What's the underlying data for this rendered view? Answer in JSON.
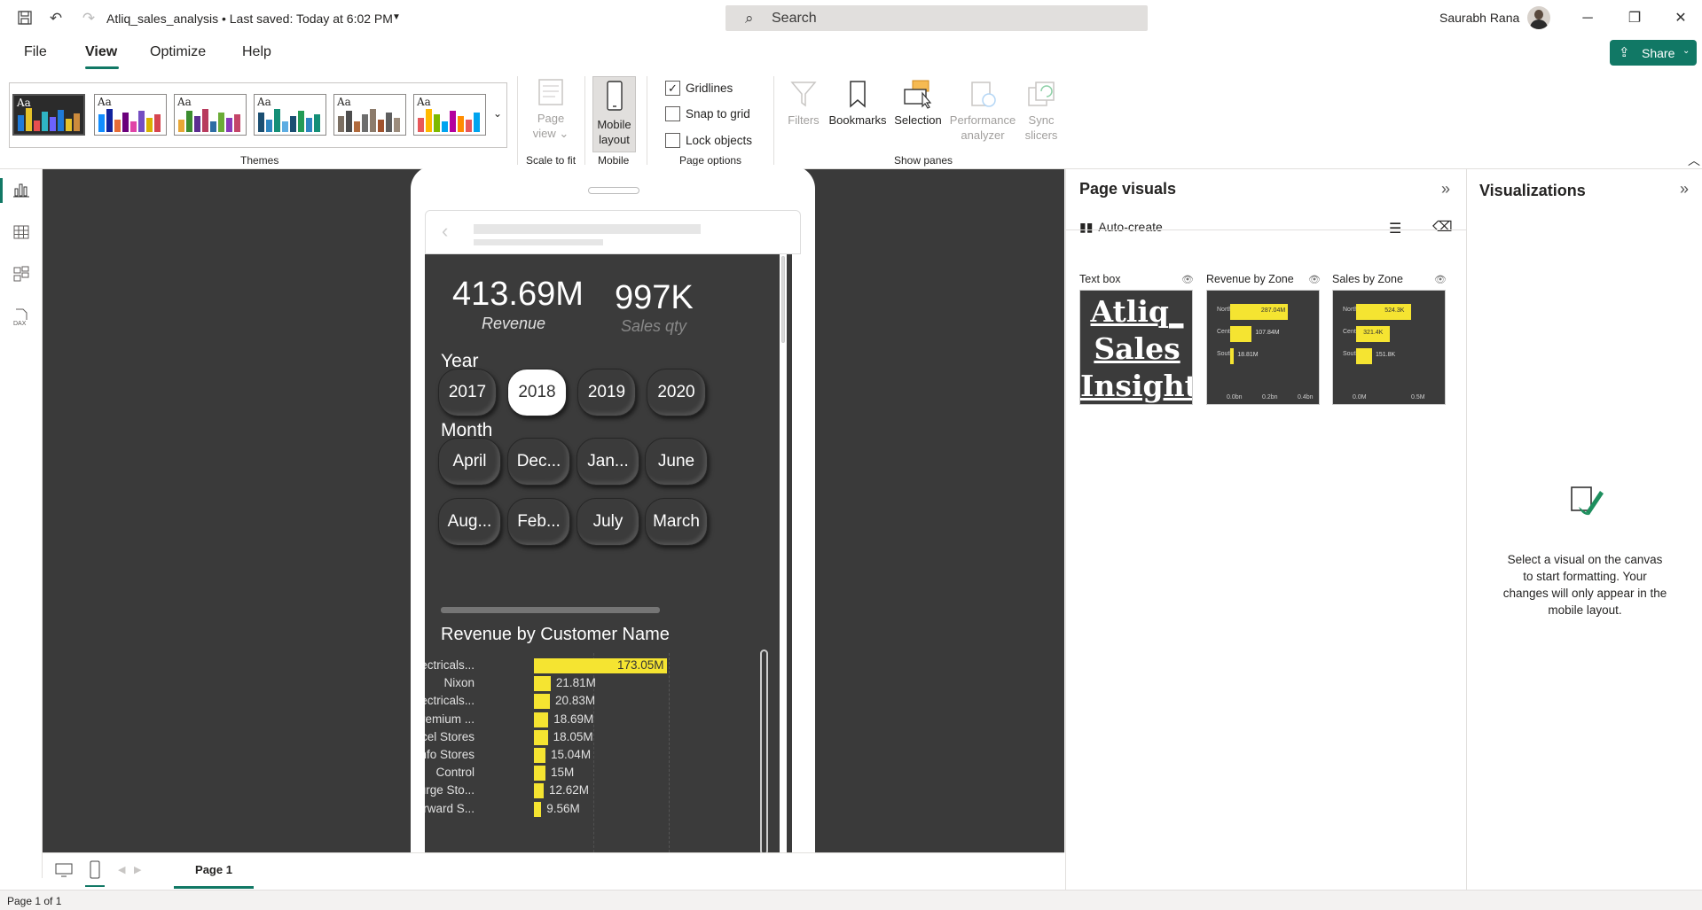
{
  "titlebar": {
    "doc_title": "Atliq_sales_analysis • Last saved: Today at 6:02 PM",
    "search_placeholder": "Search",
    "user_name": "Saurabh Rana"
  },
  "menu": {
    "tabs": [
      "File",
      "View",
      "Optimize",
      "Help"
    ],
    "share_label": "Share"
  },
  "ribbon": {
    "theme_aa": "Aa",
    "groups": {
      "themes": "Themes",
      "scale": "Scale to fit",
      "mobile": "Mobile",
      "page_options": "Page options",
      "show_panes": "Show panes"
    },
    "page_view": [
      "Page",
      "view"
    ],
    "mobile_layout": [
      "Mobile",
      "layout"
    ],
    "checks": [
      {
        "label": "Gridlines",
        "checked": true
      },
      {
        "label": "Snap to grid",
        "checked": false
      },
      {
        "label": "Lock objects",
        "checked": false
      }
    ],
    "panes": {
      "filters": "Filters",
      "bookmarks": "Bookmarks",
      "selection": "Selection",
      "perf": [
        "Performance",
        "analyzer"
      ],
      "sync": [
        "Sync",
        "slicers"
      ]
    }
  },
  "canvas": {
    "kpi_revenue": {
      "value": "413.69M",
      "label": "Revenue"
    },
    "kpi_qty": {
      "value": "997K",
      "label": "Sales qty"
    },
    "year_title": "Year",
    "years": [
      "2017",
      "2018",
      "2019",
      "2020"
    ],
    "selected_year": "2018",
    "month_title": "Month",
    "months": [
      "April",
      "Dec...",
      "Jan...",
      "June",
      "Aug...",
      "Feb...",
      "July",
      "March"
    ],
    "revenue_chart_title": "Revenue by Customer Name"
  },
  "chart_data": [
    {
      "type": "bar",
      "title": "Revenue by Customer Name",
      "categories": [
        "Electricals...",
        "Nixon",
        "Electricals...",
        "Premium ...",
        "Excel Stores",
        "Info Stores",
        "Control",
        "Surge Sto...",
        "Forward S..."
      ],
      "values": [
        173.05,
        21.81,
        20.83,
        18.69,
        18.05,
        15.04,
        15,
        12.62,
        9.56
      ],
      "value_labels": [
        "173.05M",
        "21.81M",
        "20.83M",
        "18.69M",
        "18.05M",
        "15.04M",
        "15M",
        "12.62M",
        "9.56M"
      ],
      "unit": "M"
    },
    {
      "type": "bar",
      "title": "Revenue by Zone",
      "categories": [
        "North",
        "Central",
        "South"
      ],
      "values": [
        287.04,
        107.84,
        18.81
      ],
      "value_labels": [
        "287.04M",
        "107.84M",
        "18.81M"
      ],
      "axis_ticks": [
        "0.0bn",
        "0.2bn",
        "0.4bn"
      ]
    },
    {
      "type": "bar",
      "title": "Sales by Zone",
      "categories": [
        "North",
        "Central",
        "South"
      ],
      "values": [
        524.3,
        321.4,
        151.8
      ],
      "value_labels": [
        "524.3K",
        "321.4K",
        "151.8K"
      ],
      "axis_ticks": [
        "0.0M",
        "0.5M"
      ]
    }
  ],
  "pagebar": {
    "page_tab": "Page 1",
    "status": "Page 1 of 1"
  },
  "page_visuals": {
    "title": "Page visuals",
    "auto_create": "Auto-create",
    "thumbs": [
      "Text box",
      "Revenue by Zone",
      "Sales by Zone"
    ],
    "textbox_content": [
      "Atliq_",
      "Sales",
      "Insight"
    ]
  },
  "visualizations": {
    "title": "Visualizations",
    "message": "Select a visual on the canvas to start formatting. Your changes will only appear in the mobile layout."
  },
  "colors": {
    "accent": "#117865",
    "bar": "#f5e431",
    "canvas_bg": "#3b3b3b"
  }
}
